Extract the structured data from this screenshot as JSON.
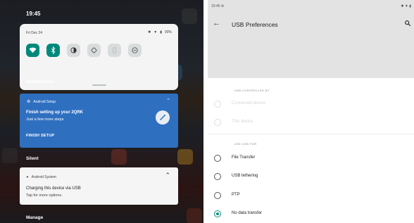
{
  "shade": {
    "time": "19:45",
    "quick_settings": {
      "date": "Fri Dec 24",
      "battery": "90%",
      "tiles": [
        {
          "icon": "wifi-icon",
          "active": true
        },
        {
          "icon": "bluetooth-icon",
          "active": true
        },
        {
          "icon": "invert-colors-icon",
          "active": false
        },
        {
          "icon": "auto-rotate-icon",
          "active": false
        },
        {
          "icon": "battery-saver-icon",
          "active": false
        },
        {
          "icon": "do-not-disturb-icon",
          "active": false
        }
      ]
    },
    "notifications_header": "Notifications",
    "setup_notification": {
      "app": "Android Setup",
      "title": "Finish setting up your 2QRK",
      "subtitle": "Just a few more steps",
      "action": "FINISH SETUP"
    },
    "silent_header": "Silent",
    "system_notification": {
      "app": "Android System",
      "title": "Charging this device via USB",
      "subtitle": "Tap for more options."
    },
    "manage_label": "Manage"
  },
  "usb": {
    "status_time": "19:45",
    "title": "USB Preferences",
    "controlled_by_label": "USB CONTROLLED BY",
    "controlled_by": [
      {
        "label": "Connected device",
        "disabled": true,
        "checked": false
      },
      {
        "label": "This device",
        "disabled": true,
        "checked": false
      }
    ],
    "use_for_label": "USE USB FOR",
    "use_for": [
      {
        "label": "File Transfer",
        "checked": false
      },
      {
        "label": "USB tethering",
        "checked": false
      },
      {
        "label": "PTP",
        "checked": false
      },
      {
        "label": "No data transfer",
        "checked": true
      }
    ]
  },
  "colors": {
    "accent": "#0b8f7f",
    "setup_card": "#2f6fc0"
  }
}
